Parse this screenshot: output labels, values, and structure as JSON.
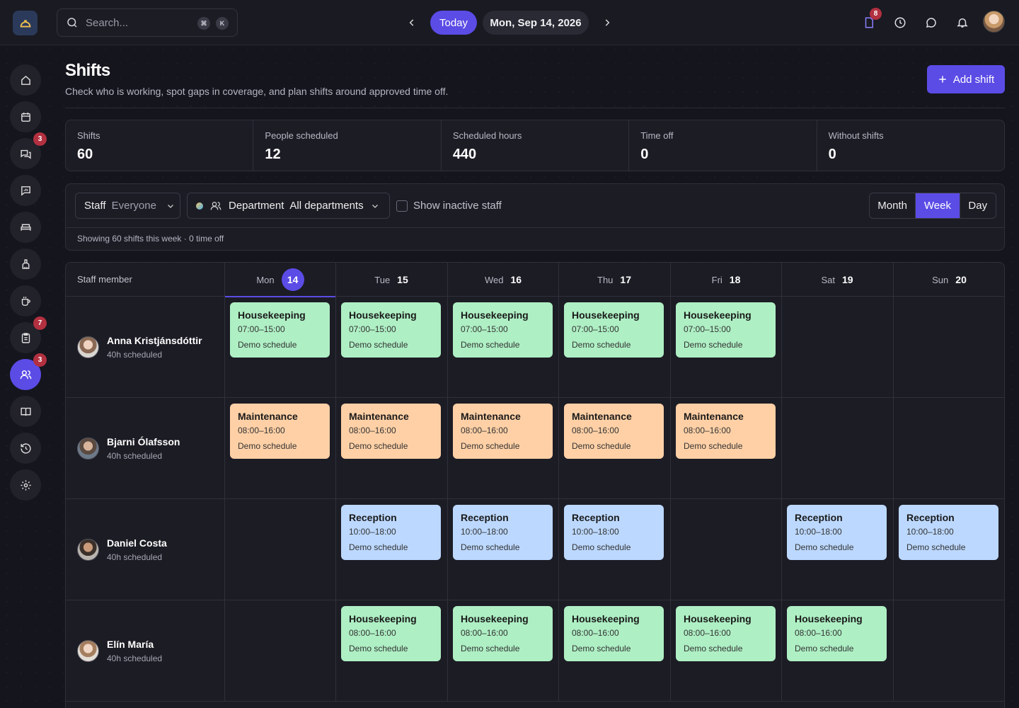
{
  "header": {
    "search_placeholder": "Search...",
    "shortcut_keys": [
      "⌘",
      "K"
    ],
    "today_label": "Today",
    "current_date": "Mon, Sep 14, 2026",
    "notifications": {
      "documents_badge": "8"
    }
  },
  "sidebar": {
    "items": [
      {
        "name": "home",
        "icon": "home-icon",
        "badge": null,
        "active": false
      },
      {
        "name": "calendar",
        "icon": "calendar-icon",
        "badge": null,
        "active": false
      },
      {
        "name": "conversations",
        "icon": "chat-bubbles-icon",
        "badge": "3",
        "active": false
      },
      {
        "name": "messages",
        "icon": "message-square-icon",
        "badge": null,
        "active": false
      },
      {
        "name": "rooms",
        "icon": "bed-icon",
        "badge": null,
        "active": false
      },
      {
        "name": "housekeeping",
        "icon": "cleaning-icon",
        "badge": null,
        "active": false
      },
      {
        "name": "services",
        "icon": "coffee-cup-icon",
        "badge": null,
        "active": false
      },
      {
        "name": "tasks",
        "icon": "clipboard-icon",
        "badge": "7",
        "active": false
      },
      {
        "name": "staff",
        "icon": "users-icon",
        "badge": "3",
        "active": true
      },
      {
        "name": "guides",
        "icon": "book-icon",
        "badge": null,
        "active": false
      },
      {
        "name": "history",
        "icon": "history-icon",
        "badge": null,
        "active": false
      },
      {
        "name": "settings",
        "icon": "gear-icon",
        "badge": null,
        "active": false
      }
    ]
  },
  "page": {
    "title": "Shifts",
    "subtitle": "Check who is working, spot gaps in coverage, and plan shifts around approved time off.",
    "add_button": "Add shift"
  },
  "stats": [
    {
      "label": "Shifts",
      "value": "60"
    },
    {
      "label": "People scheduled",
      "value": "12"
    },
    {
      "label": "Scheduled hours",
      "value": "440"
    },
    {
      "label": "Time off",
      "value": "0"
    },
    {
      "label": "Without shifts",
      "value": "0"
    }
  ],
  "filters": {
    "staff_key": "Staff",
    "staff_value": "Everyone",
    "dept_key": "Department",
    "dept_value": "All departments",
    "show_inactive": "Show inactive staff",
    "views": [
      "Month",
      "Week",
      "Day"
    ],
    "active_view": "Week",
    "summary": "Showing 60 shifts this week · 0 time off"
  },
  "schedule": {
    "staff_header": "Staff member",
    "days": [
      {
        "name": "Mon",
        "date": "14",
        "today": true
      },
      {
        "name": "Tue",
        "date": "15",
        "today": false
      },
      {
        "name": "Wed",
        "date": "16",
        "today": false
      },
      {
        "name": "Thu",
        "date": "17",
        "today": false
      },
      {
        "name": "Fri",
        "date": "18",
        "today": false
      },
      {
        "name": "Sat",
        "date": "19",
        "today": false
      },
      {
        "name": "Sun",
        "date": "20",
        "today": false
      }
    ],
    "rows": [
      {
        "name": "Anna Kristjánsdóttir",
        "hours": "40h scheduled",
        "shifts": [
          {
            "day": 0,
            "role": "Housekeeping",
            "time": "07:00–15:00",
            "note": "Demo schedule"
          },
          {
            "day": 1,
            "role": "Housekeeping",
            "time": "07:00–15:00",
            "note": "Demo schedule"
          },
          {
            "day": 2,
            "role": "Housekeeping",
            "time": "07:00–15:00",
            "note": "Demo schedule"
          },
          {
            "day": 3,
            "role": "Housekeeping",
            "time": "07:00–15:00",
            "note": "Demo schedule"
          },
          {
            "day": 4,
            "role": "Housekeeping",
            "time": "07:00–15:00",
            "note": "Demo schedule"
          }
        ]
      },
      {
        "name": "Bjarni Ólafsson",
        "hours": "40h scheduled",
        "shifts": [
          {
            "day": 0,
            "role": "Maintenance",
            "time": "08:00–16:00",
            "note": "Demo schedule"
          },
          {
            "day": 1,
            "role": "Maintenance",
            "time": "08:00–16:00",
            "note": "Demo schedule"
          },
          {
            "day": 2,
            "role": "Maintenance",
            "time": "08:00–16:00",
            "note": "Demo schedule"
          },
          {
            "day": 3,
            "role": "Maintenance",
            "time": "08:00–16:00",
            "note": "Demo schedule"
          },
          {
            "day": 4,
            "role": "Maintenance",
            "time": "08:00–16:00",
            "note": "Demo schedule"
          }
        ]
      },
      {
        "name": "Daniel Costa",
        "hours": "40h scheduled",
        "shifts": [
          {
            "day": 1,
            "role": "Reception",
            "time": "10:00–18:00",
            "note": "Demo schedule"
          },
          {
            "day": 2,
            "role": "Reception",
            "time": "10:00–18:00",
            "note": "Demo schedule"
          },
          {
            "day": 3,
            "role": "Reception",
            "time": "10:00–18:00",
            "note": "Demo schedule"
          },
          {
            "day": 5,
            "role": "Reception",
            "time": "10:00–18:00",
            "note": "Demo schedule"
          },
          {
            "day": 6,
            "role": "Reception",
            "time": "10:00–18:00",
            "note": "Demo schedule"
          }
        ]
      },
      {
        "name": "Elín María",
        "hours": "40h scheduled",
        "shifts": [
          {
            "day": 1,
            "role": "Housekeeping",
            "time": "08:00–16:00",
            "note": "Demo schedule"
          },
          {
            "day": 2,
            "role": "Housekeeping",
            "time": "08:00–16:00",
            "note": "Demo schedule"
          },
          {
            "day": 3,
            "role": "Housekeeping",
            "time": "08:00–16:00",
            "note": "Demo schedule"
          },
          {
            "day": 4,
            "role": "Housekeeping",
            "time": "08:00–16:00",
            "note": "Demo schedule"
          },
          {
            "day": 5,
            "role": "Housekeeping",
            "time": "08:00–16:00",
            "note": "Demo schedule"
          }
        ]
      }
    ]
  },
  "colors": {
    "accent": "#5b4ce6",
    "housekeeping": "#aeefc4",
    "maintenance": "#ffd0a6",
    "reception": "#bcd8ff",
    "badge": "#b2303f"
  }
}
